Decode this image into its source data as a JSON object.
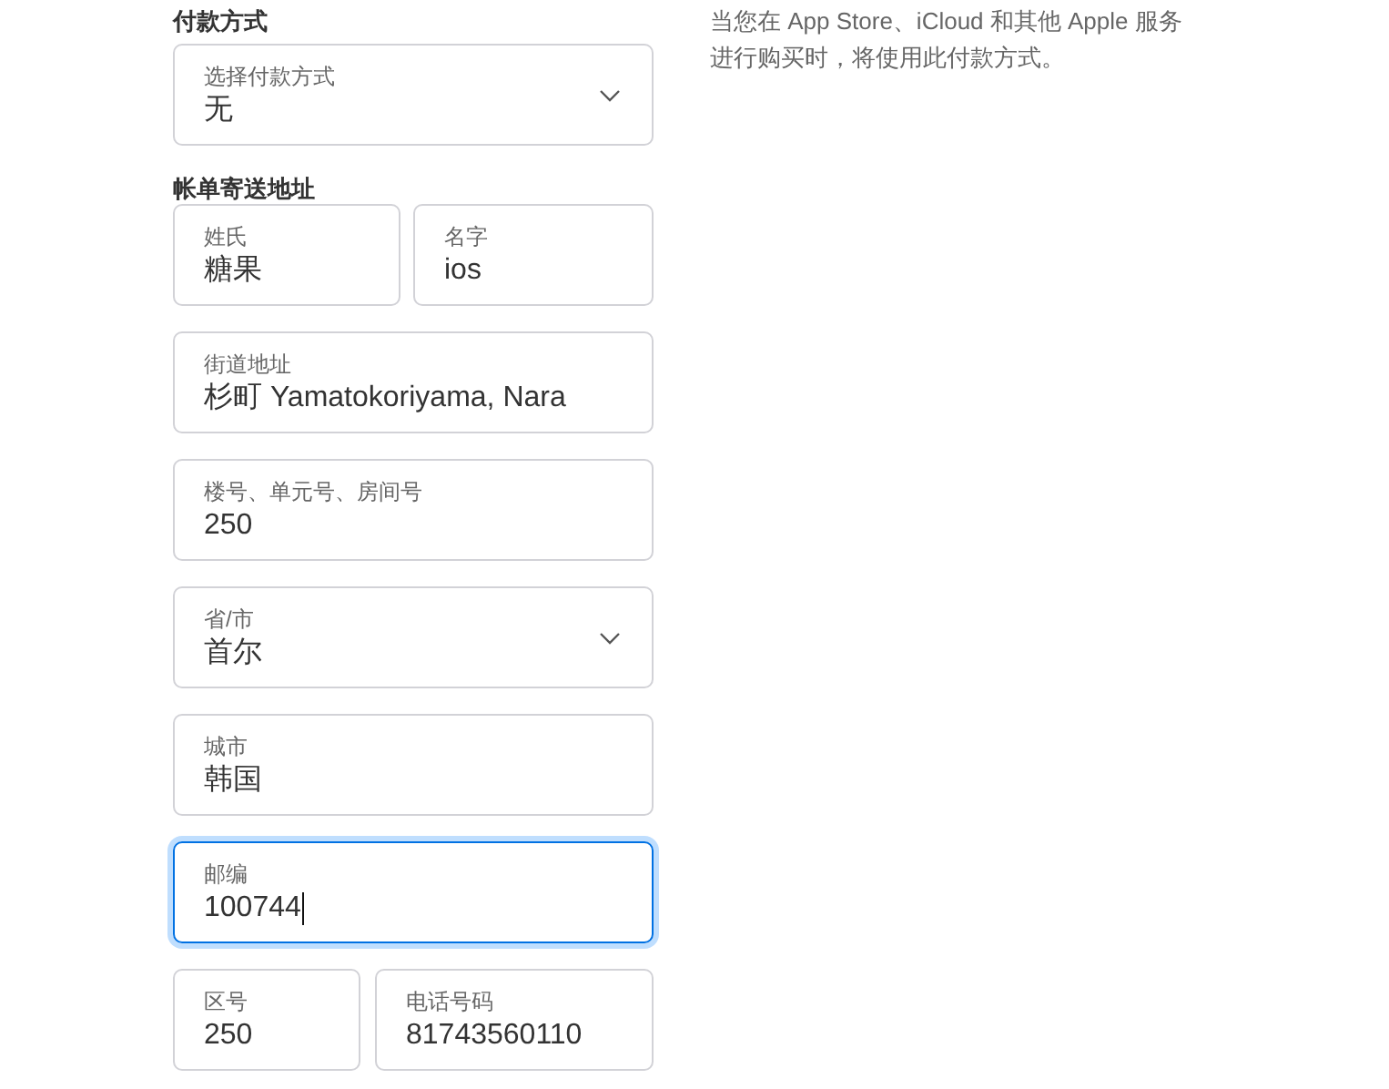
{
  "payment": {
    "heading": "付款方式",
    "field": {
      "kind": "select",
      "label": "选择付款方式",
      "value": "无",
      "focused": false
    },
    "note": "当您在 App Store、iCloud 和其他 Apple 服务进行购买时，将使用此付款方式。"
  },
  "billing": {
    "heading": "帐单寄送地址",
    "rows": [
      {
        "fields": [
          {
            "kind": "text",
            "label": "姓氏",
            "value": "糖果",
            "focused": false
          },
          {
            "kind": "text",
            "label": "名字",
            "value": "ios",
            "focused": false
          }
        ]
      },
      {
        "fields": [
          {
            "kind": "text",
            "label": "街道地址",
            "value": "杉町 Yamatokoriyama, Nara",
            "focused": false
          }
        ]
      },
      {
        "fields": [
          {
            "kind": "text",
            "label": "楼号、单元号、房间号",
            "value": "250",
            "focused": false
          }
        ]
      },
      {
        "fields": [
          {
            "kind": "select",
            "label": "省/市",
            "value": "首尔",
            "focused": false
          }
        ]
      },
      {
        "fields": [
          {
            "kind": "text",
            "label": "城市",
            "value": "韩国",
            "focused": false
          }
        ]
      },
      {
        "fields": [
          {
            "kind": "text",
            "label": "邮编",
            "value": "100744",
            "focused": true
          }
        ]
      },
      {
        "fields": [
          {
            "kind": "text",
            "label": "区号",
            "value": "250",
            "focused": false
          },
          {
            "kind": "text",
            "label": "电话号码",
            "value": "81743560110",
            "focused": false
          }
        ]
      }
    ]
  }
}
